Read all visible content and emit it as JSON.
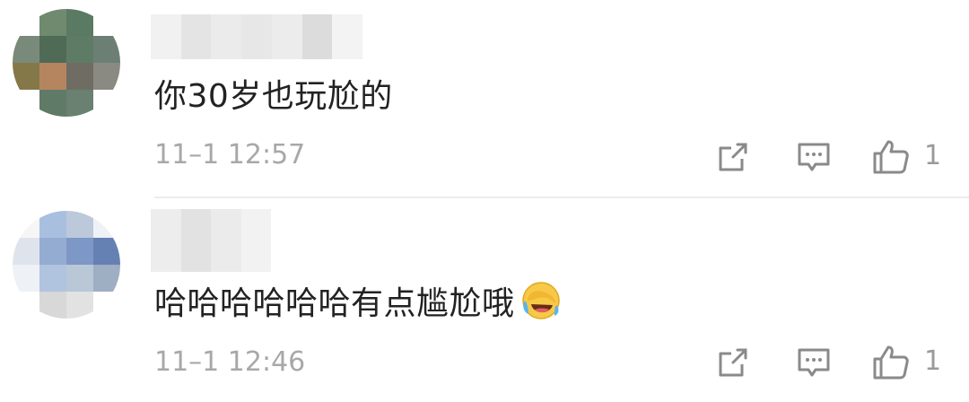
{
  "comments": [
    {
      "text": "你30岁也玩尬的",
      "time": "11–1 12:57",
      "like_count": "1",
      "avatar_colors": [
        "#ffffff",
        "#6f8a6e",
        "#5b7a63",
        "#ffffff",
        "#7a8a7a",
        "#4f6b55",
        "#5e7b66",
        "#6b7f74",
        "#857848",
        "#b58560",
        "#6f6d63",
        "#8a8a82",
        "#ffffff",
        "#5f7a66",
        "#6a8070",
        "#ffffff"
      ],
      "username_colors": [
        "#f1f1f1",
        "#e4e4e4",
        "#ebebeb",
        "#e7e7e7",
        "#ececec",
        "#dcdcdc",
        "#f3f3f3"
      ]
    },
    {
      "text": "哈哈哈哈哈哈有点尴尬哦",
      "emoji_name": "laughing-crying-emoji",
      "time": "11–1 12:46",
      "like_count": "1",
      "avatar_colors": [
        "#f6f6f6",
        "#a9bfe0",
        "#bcc9da",
        "#eef1f6",
        "#dfe4ec",
        "#94acd2",
        "#7d98c6",
        "#6580b3",
        "#eef1f6",
        "#b0c4df",
        "#b9c7d7",
        "#9eaec3",
        "#ffffff",
        "#d8d8d8",
        "#e2e2e2",
        "#ffffff"
      ],
      "username_colors": [
        "#ededed",
        "#e2e2e2",
        "#ebebeb",
        "#f2f2f2"
      ]
    }
  ],
  "icons": {
    "share": "share-icon",
    "reply": "comment-reply-icon",
    "like": "thumbs-up-icon"
  },
  "colors": {
    "text": "#222222",
    "time": "#a8a8a8",
    "icon": "#8a8a8a",
    "divider": "#ececec"
  }
}
